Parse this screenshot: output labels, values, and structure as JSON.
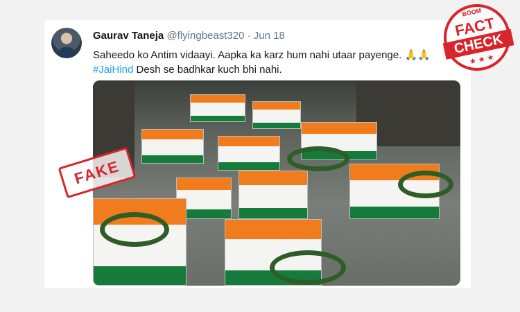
{
  "tweet": {
    "author_name": "Gaurav Taneja",
    "handle": "@flyingbeast320",
    "separator": "·",
    "date": "Jun 18",
    "text_line1": "Saheedo ko Antim vidaayi. Aapka ka karz hum nahi utaar payenge.",
    "pray_emoji": "🙏🙏",
    "hashtag": "#JaiHind",
    "text_line2_rest": " Desh se badhkar kuch bhi nahi."
  },
  "stamps": {
    "fake": "FAKE",
    "factcheck_brand": "BOOM",
    "factcheck_top": "FACT",
    "factcheck_bottom": "CHECK",
    "factcheck_stars": "★ ★ ★"
  },
  "colors": {
    "link": "#1da1f2",
    "stamp_red": "#d9242b",
    "saffron": "#f07c1e",
    "green": "#157a3a"
  }
}
